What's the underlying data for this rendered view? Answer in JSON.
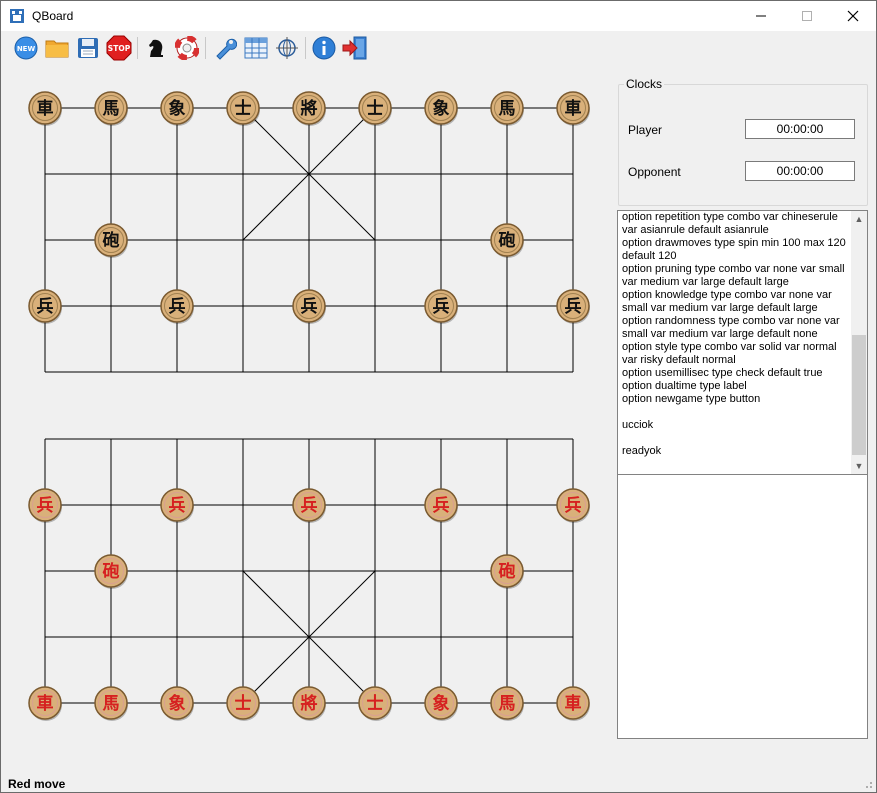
{
  "window": {
    "title": "QBoard"
  },
  "toolbar": {
    "items": [
      {
        "name": "new-game",
        "icon": "new-icon",
        "label": "NEW"
      },
      {
        "name": "open",
        "icon": "folder-icon"
      },
      {
        "name": "save",
        "icon": "floppy-icon"
      },
      {
        "name": "stop",
        "icon": "stop-icon",
        "label": "STOP"
      },
      {
        "name": "engine",
        "icon": "knight-icon"
      },
      {
        "name": "help-ring",
        "icon": "lifebuoy-icon"
      },
      {
        "name": "settings",
        "icon": "wrench-icon"
      },
      {
        "name": "table",
        "icon": "table-icon"
      },
      {
        "name": "network",
        "icon": "network-icon"
      },
      {
        "name": "about",
        "icon": "info-icon"
      },
      {
        "name": "exit",
        "icon": "exit-icon"
      }
    ]
  },
  "board": {
    "black_pieces": [
      {
        "char": "車",
        "file": 0,
        "rank": 0
      },
      {
        "char": "馬",
        "file": 1,
        "rank": 0
      },
      {
        "char": "象",
        "file": 2,
        "rank": 0
      },
      {
        "char": "士",
        "file": 3,
        "rank": 0
      },
      {
        "char": "將",
        "file": 4,
        "rank": 0
      },
      {
        "char": "士",
        "file": 5,
        "rank": 0
      },
      {
        "char": "象",
        "file": 6,
        "rank": 0
      },
      {
        "char": "馬",
        "file": 7,
        "rank": 0
      },
      {
        "char": "車",
        "file": 8,
        "rank": 0
      },
      {
        "char": "砲",
        "file": 1,
        "rank": 2
      },
      {
        "char": "砲",
        "file": 7,
        "rank": 2
      },
      {
        "char": "兵",
        "file": 0,
        "rank": 3
      },
      {
        "char": "兵",
        "file": 2,
        "rank": 3
      },
      {
        "char": "兵",
        "file": 4,
        "rank": 3
      },
      {
        "char": "兵",
        "file": 6,
        "rank": 3
      },
      {
        "char": "兵",
        "file": 8,
        "rank": 3
      }
    ],
    "red_pieces": [
      {
        "char": "兵",
        "file": 0,
        "rank": 6
      },
      {
        "char": "兵",
        "file": 2,
        "rank": 6
      },
      {
        "char": "兵",
        "file": 4,
        "rank": 6
      },
      {
        "char": "兵",
        "file": 6,
        "rank": 6
      },
      {
        "char": "兵",
        "file": 8,
        "rank": 6
      },
      {
        "char": "砲",
        "file": 1,
        "rank": 7
      },
      {
        "char": "砲",
        "file": 7,
        "rank": 7
      },
      {
        "char": "車",
        "file": 0,
        "rank": 9
      },
      {
        "char": "馬",
        "file": 1,
        "rank": 9
      },
      {
        "char": "象",
        "file": 2,
        "rank": 9
      },
      {
        "char": "士",
        "file": 3,
        "rank": 9
      },
      {
        "char": "將",
        "file": 4,
        "rank": 9
      },
      {
        "char": "士",
        "file": 5,
        "rank": 9
      },
      {
        "char": "象",
        "file": 6,
        "rank": 9
      },
      {
        "char": "馬",
        "file": 7,
        "rank": 9
      },
      {
        "char": "車",
        "file": 8,
        "rank": 9
      }
    ],
    "colors": {
      "piece_face": "#d9b07a",
      "black_text": "#111111",
      "red_text": "#d62020"
    }
  },
  "clocks": {
    "title": "Clocks",
    "player_label": "Player",
    "player_time": "00:00:00",
    "opponent_label": "Opponent",
    "opponent_time": "00:00:00"
  },
  "log": {
    "text": "option repetition type combo var chineserule\nvar asianrule default asianrule\noption drawmoves type spin min 100 max 120\ndefault 120\noption pruning type combo var none var small\nvar medium var large default large\noption knowledge type combo var none var\nsmall var medium var large default large\noption randomness type combo var none var\nsmall var medium var large default none\noption style type combo var solid var normal\nvar risky default normal\noption usemillisec type check default true\noption dualtime type label\noption newgame type button\n\nucciok\n\nreadyok"
  },
  "status": {
    "text": "Red move"
  }
}
